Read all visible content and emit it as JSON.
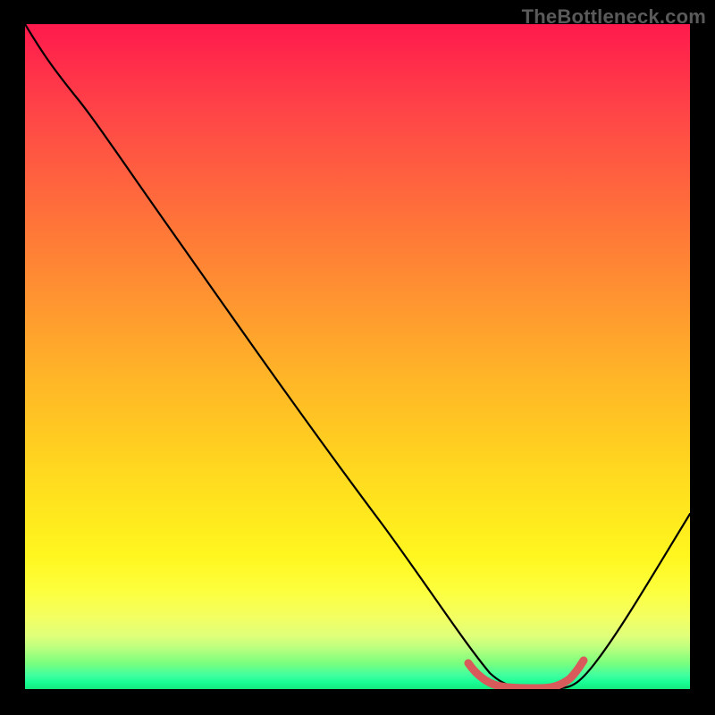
{
  "watermark": "TheBottleneck.com",
  "chart_data": {
    "type": "line",
    "title": "",
    "xlabel": "",
    "ylabel": "",
    "xlim": [
      0,
      100
    ],
    "ylim": [
      0,
      100
    ],
    "series": [
      {
        "name": "curve",
        "color": "#000000",
        "x": [
          0,
          4,
          8,
          12,
          20,
          30,
          40,
          50,
          58,
          63,
          66,
          70,
          74,
          77,
          80,
          84,
          88,
          92,
          96,
          100
        ],
        "y": [
          100,
          96,
          92,
          88,
          78,
          65,
          52,
          38,
          27,
          18,
          12,
          5,
          1,
          0,
          0,
          1,
          6,
          14,
          23,
          33
        ]
      },
      {
        "name": "valley-highlight",
        "color": "#d85a5a",
        "x": [
          67,
          70,
          73,
          76,
          78,
          80,
          82
        ],
        "y": [
          3.5,
          1.2,
          0.4,
          0.1,
          0.1,
          0.5,
          2.8
        ]
      }
    ],
    "gradient_stops": [
      {
        "pos": 0,
        "color": "#ff1a4d"
      },
      {
        "pos": 14,
        "color": "#ff4747"
      },
      {
        "pos": 32,
        "color": "#ff7a37"
      },
      {
        "pos": 52,
        "color": "#ffb228"
      },
      {
        "pos": 72,
        "color": "#ffe41e"
      },
      {
        "pos": 89,
        "color": "#f4ff60"
      },
      {
        "pos": 96,
        "color": "#7dff7d"
      },
      {
        "pos": 100,
        "color": "#14e87e"
      }
    ]
  }
}
